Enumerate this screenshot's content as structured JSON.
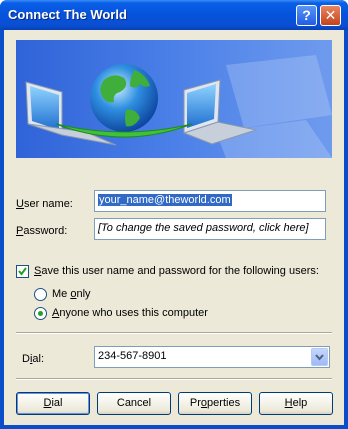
{
  "window": {
    "title": "Connect The World",
    "help_glyph": "?",
    "close_glyph": "✕"
  },
  "form": {
    "user_name_label_u": "U",
    "user_name_label_rest": "ser name:",
    "user_name_value": "your_name@theworld.com",
    "password_label_u": "P",
    "password_label_rest": "assword:",
    "password_placeholder": "[To change the saved password, click here]",
    "save_label_u": "S",
    "save_label_rest": "ave this user name and password for the following users:",
    "save_checked": true,
    "me_only_pre": "Me ",
    "me_only_u": "o",
    "me_only_rest": "nly",
    "anyone_u": "A",
    "anyone_rest": "nyone who uses this computer",
    "selected_option": "Anyone who uses this computer",
    "dial_label_pre": "D",
    "dial_label_u": "i",
    "dial_label_rest": "al:",
    "dial_value": "234-567-8901"
  },
  "buttons": {
    "dial_u": "D",
    "dial_rest": "ial",
    "cancel": "Cancel",
    "properties_pre": "Pr",
    "properties_u": "o",
    "properties_rest": "perties",
    "help_u": "H",
    "help_rest": "elp"
  },
  "icons": {
    "banner": "globe-connecting-laptops-illustration",
    "check": "checkmark-icon",
    "dropdown": "chevron-down-icon"
  },
  "colors": {
    "titlebar": "#0553dc",
    "client": "#ece9d8",
    "selection": "#316ac5"
  }
}
